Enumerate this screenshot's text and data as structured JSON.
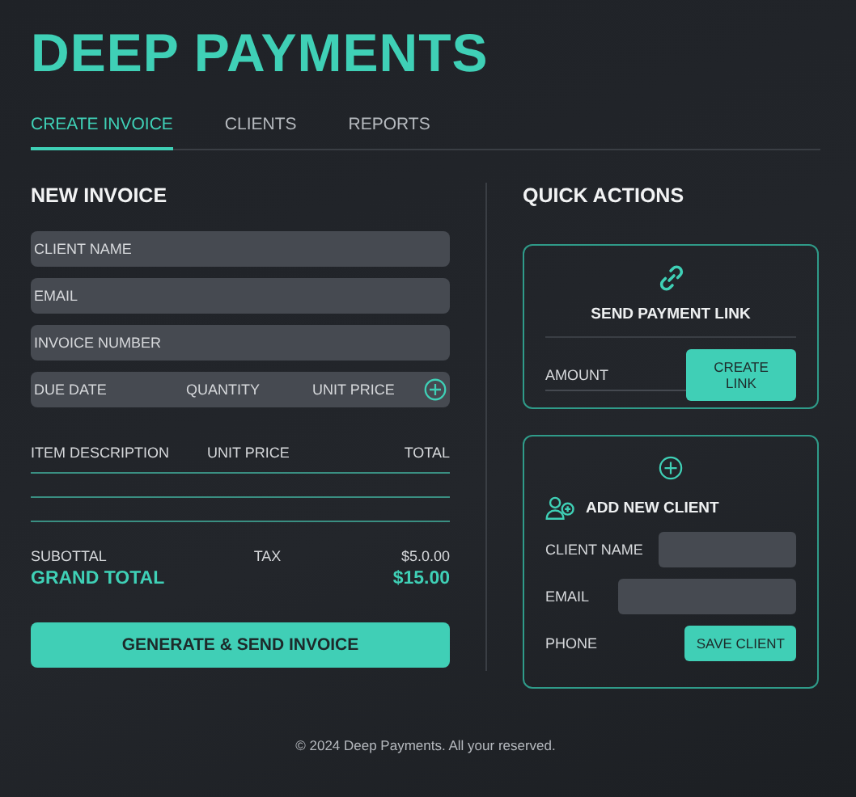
{
  "app": {
    "title": "DEEP PAYMENTS"
  },
  "tabs": [
    {
      "label": "CREATE INVOICE",
      "selected": true
    },
    {
      "label": "CLIENTS",
      "selected": false
    },
    {
      "label": "REPORTS",
      "selected": false
    }
  ],
  "invoice": {
    "heading": "NEW INVOICE",
    "fields": [
      {
        "placeholder": "CLIENT NAME"
      },
      {
        "placeholder": "EMAIL"
      },
      {
        "placeholder": "INVOICE NUMBER"
      }
    ],
    "line_fields": [
      {
        "placeholder": "DUE DATE"
      },
      {
        "placeholder": "QUANTITY"
      },
      {
        "placeholder": "UNIT PRICE"
      }
    ],
    "columns": [
      "ITEM DESCRIPTION",
      "UNIT PRICE",
      "TOTAL"
    ],
    "subtotal_label": "SUBOTTAL",
    "tax_label": "TAX",
    "subtotal_value": "$5.0.00",
    "grand_total_label": "GRAND TOTAL",
    "grand_total_value": "$15.00",
    "submit": "GENERATE & SEND INVOICE"
  },
  "quick_actions": {
    "heading": "QUICK ACTIONS",
    "payment_link": {
      "title": "SEND PAYMENT LINK",
      "amount_placeholder": "AMOUNT",
      "button": "CREATE LINK"
    },
    "new_client": {
      "title": "ADD NEW CLIENT",
      "name_label": "CLIENT NAME",
      "email_label": "EMAIL",
      "phone_label": "PHONE",
      "button": "SAVE CLIENT"
    }
  },
  "footer": "© 2024 Deep Payments. All your reserved."
}
